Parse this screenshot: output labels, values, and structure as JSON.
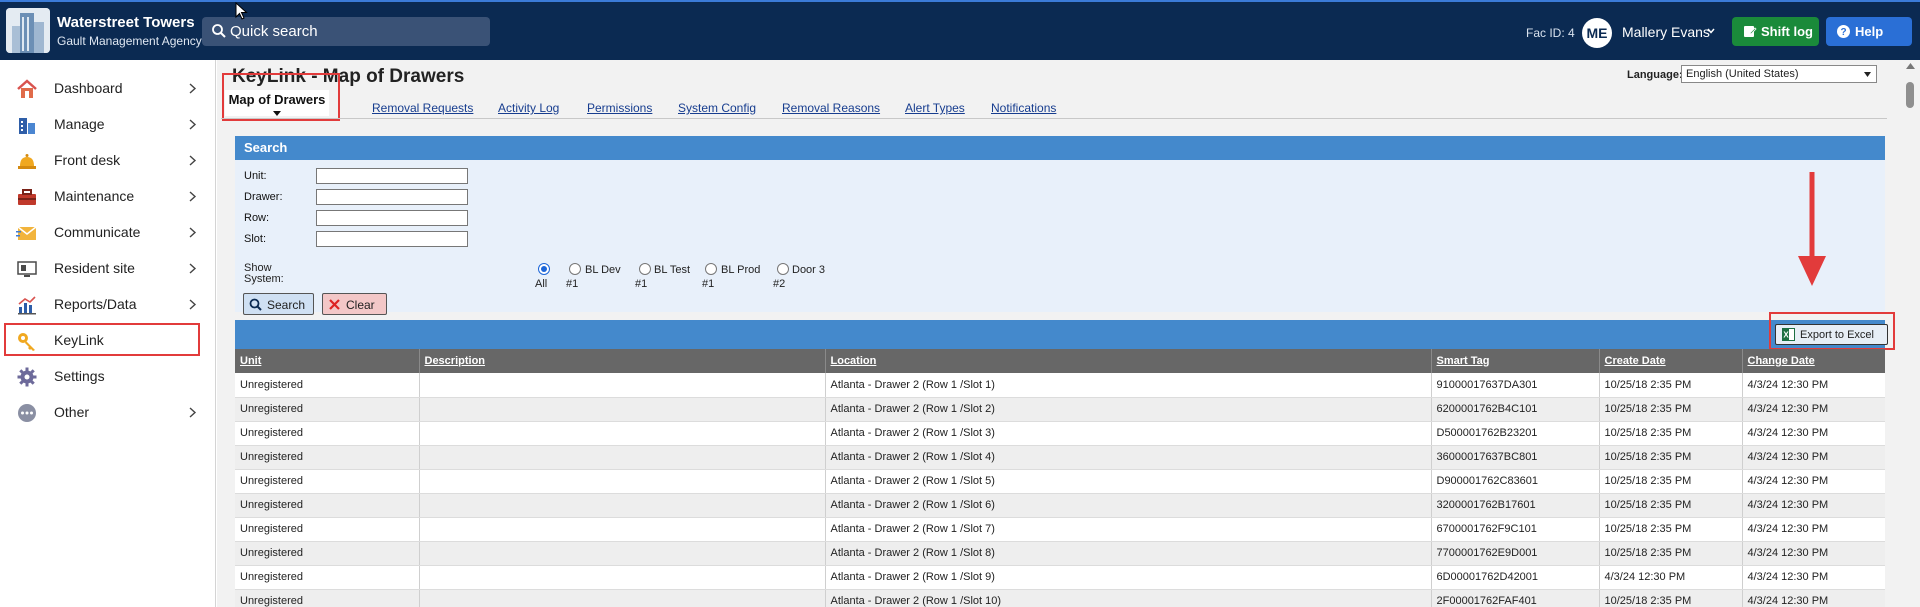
{
  "header": {
    "brand_title": "Waterstreet Towers",
    "brand_subtitle": "Gault Management Agency",
    "search_placeholder": "Quick search",
    "fac_id": "Fac ID: 4",
    "user_initials": "ME",
    "user_name": "Mallery Evans",
    "shift_log_label": "Shift log",
    "help_label": "Help"
  },
  "sidebar": {
    "items": [
      {
        "label": "Dashboard",
        "icon": "house-icon",
        "chevron": true
      },
      {
        "label": "Manage",
        "icon": "buildings-icon",
        "chevron": true
      },
      {
        "label": "Front desk",
        "icon": "bell-icon",
        "chevron": true
      },
      {
        "label": "Maintenance",
        "icon": "toolbox-icon",
        "chevron": true
      },
      {
        "label": "Communicate",
        "icon": "envelope-icon",
        "chevron": true
      },
      {
        "label": "Resident site",
        "icon": "monitor-icon",
        "chevron": true
      },
      {
        "label": "Reports/Data",
        "icon": "bar-chart-icon",
        "chevron": true
      },
      {
        "label": "KeyLink",
        "icon": "key-icon",
        "chevron": false,
        "active": true
      },
      {
        "label": "Settings",
        "icon": "gear-icon",
        "chevron": false
      },
      {
        "label": "Other",
        "icon": "more-dots-icon",
        "chevron": true
      }
    ]
  },
  "page": {
    "title": "KeyLink - Map of Drawers",
    "language_label": "Language:",
    "language_value": "English (United States)",
    "tabs": [
      {
        "label": "Map of Drawers",
        "active": true
      },
      {
        "label": "Removal Requests"
      },
      {
        "label": "Activity Log"
      },
      {
        "label": "Permissions"
      },
      {
        "label": "System Config"
      },
      {
        "label": "Removal Reasons"
      },
      {
        "label": "Alert Types"
      },
      {
        "label": "Notifications"
      }
    ]
  },
  "search": {
    "header": "Search",
    "fields": [
      {
        "label": "Unit:",
        "value": ""
      },
      {
        "label": "Drawer:",
        "value": ""
      },
      {
        "label": "Row:",
        "value": ""
      },
      {
        "label": "Slot:",
        "value": ""
      }
    ],
    "show_system_label": "Show System:",
    "systems": [
      {
        "label": "All",
        "sub": "",
        "selected": true
      },
      {
        "label": "BL Dev",
        "sub": "#1",
        "selected": false
      },
      {
        "label": "BL Test",
        "sub": "#1",
        "selected": false
      },
      {
        "label": "BL Prod",
        "sub": "#1",
        "selected": false
      },
      {
        "label": "Door 3",
        "sub": "#2",
        "selected": false
      }
    ],
    "search_button": "Search",
    "clear_button": "Clear"
  },
  "results": {
    "export_label": "Export to Excel",
    "columns": [
      "Unit",
      "Description",
      "Location",
      "Smart Tag",
      "Create Date",
      "Change Date"
    ],
    "rows": [
      [
        "Unregistered",
        "",
        "Atlanta - Drawer 2 (Row 1 /Slot 1)",
        "91000017637DA301",
        "10/25/18 2:35 PM",
        "4/3/24 12:30 PM"
      ],
      [
        "Unregistered",
        "",
        "Atlanta - Drawer 2 (Row 1 /Slot 2)",
        "6200001762B4C101",
        "10/25/18 2:35 PM",
        "4/3/24 12:30 PM"
      ],
      [
        "Unregistered",
        "",
        "Atlanta - Drawer 2 (Row 1 /Slot 3)",
        "D500001762B23201",
        "10/25/18 2:35 PM",
        "4/3/24 12:30 PM"
      ],
      [
        "Unregistered",
        "",
        "Atlanta - Drawer 2 (Row 1 /Slot 4)",
        "36000017637BC801",
        "10/25/18 2:35 PM",
        "4/3/24 12:30 PM"
      ],
      [
        "Unregistered",
        "",
        "Atlanta - Drawer 2 (Row 1 /Slot 5)",
        "D900001762C83601",
        "10/25/18 2:35 PM",
        "4/3/24 12:30 PM"
      ],
      [
        "Unregistered",
        "",
        "Atlanta - Drawer 2 (Row 1 /Slot 6)",
        "3200001762B17601",
        "10/25/18 2:35 PM",
        "4/3/24 12:30 PM"
      ],
      [
        "Unregistered",
        "",
        "Atlanta - Drawer 2 (Row 1 /Slot 7)",
        "6700001762F9C101",
        "10/25/18 2:35 PM",
        "4/3/24 12:30 PM"
      ],
      [
        "Unregistered",
        "",
        "Atlanta - Drawer 2 (Row 1 /Slot 8)",
        "7700001762E9D001",
        "10/25/18 2:35 PM",
        "4/3/24 12:30 PM"
      ],
      [
        "Unregistered",
        "",
        "Atlanta - Drawer 2 (Row 1 /Slot 9)",
        "6D00001762D42001",
        "4/3/24 12:30 PM",
        "4/3/24 12:30 PM"
      ],
      [
        "Unregistered",
        "",
        "Atlanta - Drawer 2 (Row 1 /Slot 10)",
        "2F00001762FAF401",
        "10/25/18 2:35 PM",
        "4/3/24 12:30 PM"
      ]
    ]
  },
  "colors": {
    "topbar": "#0b2a52",
    "accent_blue": "#4489cc",
    "shift_log_green": "#1a8a3a",
    "help_blue": "#2a6fd6",
    "highlight_red": "#e23b3b"
  }
}
